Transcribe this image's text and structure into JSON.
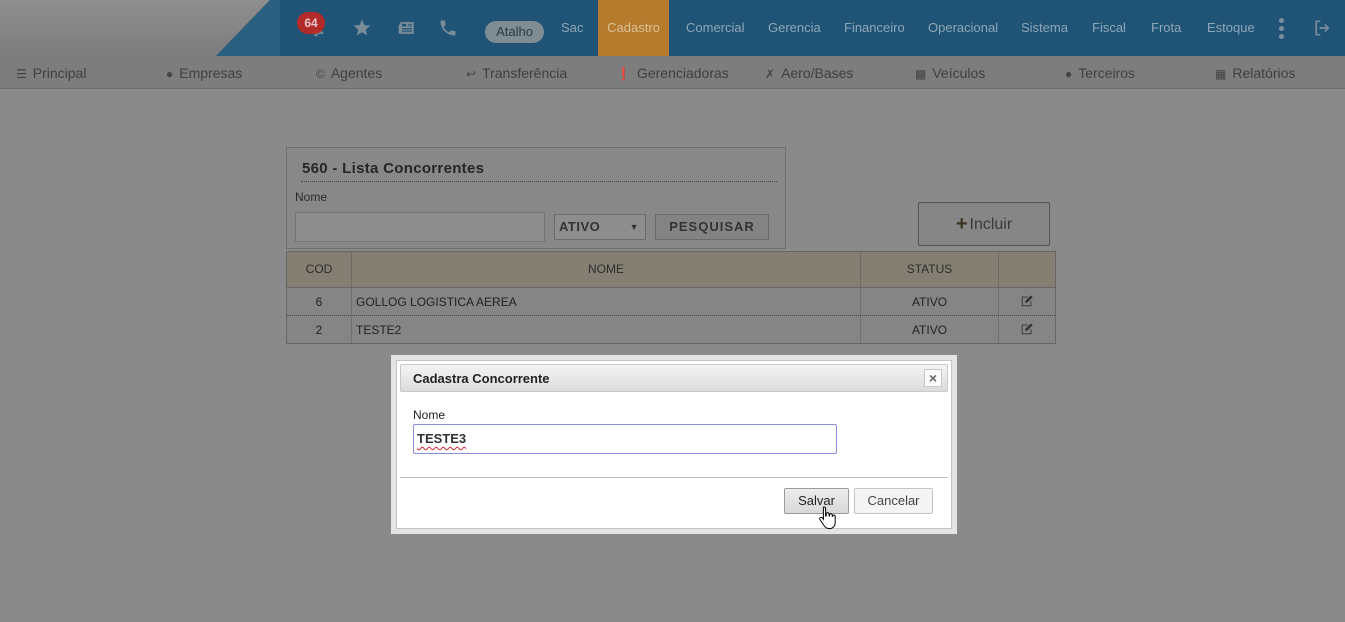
{
  "topbar": {
    "notification_count": "64",
    "atalho_label": "Atalho",
    "menu": [
      {
        "label": "Sac",
        "active": false
      },
      {
        "label": "Cadastro",
        "active": true
      },
      {
        "label": "Comercial",
        "active": false
      },
      {
        "label": "Gerencia",
        "active": false
      },
      {
        "label": "Financeiro",
        "active": false
      },
      {
        "label": "Operacional",
        "active": false
      },
      {
        "label": "Sistema",
        "active": false
      },
      {
        "label": "Fiscal",
        "active": false
      },
      {
        "label": "Frota",
        "active": false
      },
      {
        "label": "Estoque",
        "active": false
      }
    ],
    "icons": [
      "bell-icon",
      "star-icon",
      "newspaper-icon",
      "phone-icon",
      "kebab-menu-icon",
      "logout-icon"
    ]
  },
  "subnav": {
    "items": [
      {
        "label": "Principal",
        "icon": "database-icon"
      },
      {
        "label": "Empresas",
        "icon": "user-icon"
      },
      {
        "label": "Agentes",
        "icon": "copyright-icon"
      },
      {
        "label": "Transferência",
        "icon": "reply-icon"
      },
      {
        "label": "Gerenciadoras",
        "icon": "exclamation-circle-icon"
      },
      {
        "label": "Aero/Bases",
        "icon": "plane-icon"
      },
      {
        "label": "Veículos",
        "icon": "car-icon"
      },
      {
        "label": "Terceiros",
        "icon": "user-icon"
      },
      {
        "label": "Relatórios",
        "icon": "table-icon"
      }
    ]
  },
  "panel": {
    "title": "560 - Lista Concorrentes",
    "name_label": "Nome",
    "name_value": "",
    "status_selected": "ATIVO",
    "search_button": "PESQUISAR"
  },
  "incluir_button": "Incluir",
  "table": {
    "headers": [
      "COD",
      "NOME",
      "STATUS",
      ""
    ],
    "rows": [
      {
        "cod": "6",
        "nome": "GOLLOG LOGISTICA AEREA",
        "status": "ATIVO"
      },
      {
        "cod": "2",
        "nome": "TESTE2",
        "status": "ATIVO"
      }
    ]
  },
  "dialog": {
    "title": "Cadastra Concorrente",
    "close_glyph": "×",
    "name_label": "Nome",
    "name_value": "TESTE3",
    "save_button": "Salvar",
    "cancel_button": "Cancelar"
  },
  "colors": {
    "topbar": "#1f5476",
    "active_menu": "#b57a2c",
    "overlay": "#8a8a8a",
    "badge": "#b22a2a"
  }
}
